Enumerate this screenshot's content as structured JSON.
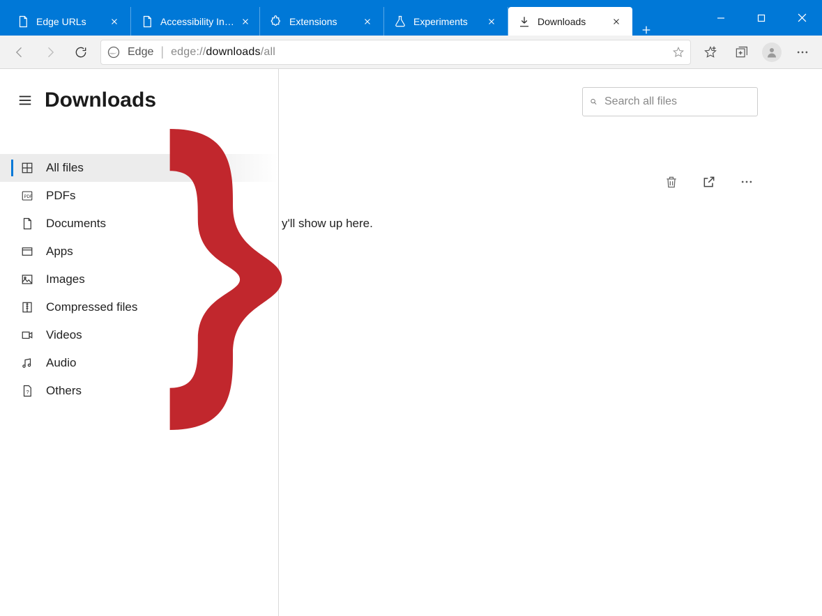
{
  "tabs": [
    {
      "label": "Edge URLs",
      "icon": "page-icon"
    },
    {
      "label": "Accessibility Internals",
      "icon": "page-icon"
    },
    {
      "label": "Extensions",
      "icon": "puzzle-icon"
    },
    {
      "label": "Experiments",
      "icon": "flask-icon"
    },
    {
      "label": "Downloads",
      "icon": "download-icon",
      "active": true
    }
  ],
  "omnibox": {
    "product": "Edge",
    "url_prefix": "edge://",
    "url_strong": "downloads",
    "url_suffix": "/all"
  },
  "sidebar": {
    "title": "Downloads",
    "items": [
      {
        "label": "All files",
        "icon": "grid-icon",
        "selected": true
      },
      {
        "label": "PDFs",
        "icon": "pdf-icon"
      },
      {
        "label": "Documents",
        "icon": "document-icon"
      },
      {
        "label": "Apps",
        "icon": "app-icon"
      },
      {
        "label": "Images",
        "icon": "image-icon"
      },
      {
        "label": "Compressed files",
        "icon": "zip-icon"
      },
      {
        "label": "Videos",
        "icon": "video-icon"
      },
      {
        "label": "Audio",
        "icon": "audio-icon"
      },
      {
        "label": "Others",
        "icon": "others-icon"
      }
    ]
  },
  "search": {
    "placeholder": "Search all files"
  },
  "empty_message": "y'll show up here."
}
